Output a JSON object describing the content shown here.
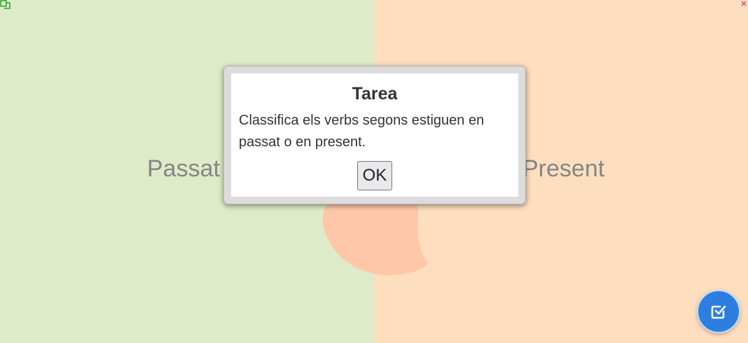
{
  "zones": {
    "left_label": "Passat",
    "right_label": "Present",
    "left_color": "#dfebc8",
    "right_color": "#fddfbf"
  },
  "dialog": {
    "title": "Tarea",
    "message": "Classifica els verbs segons estiguen en passat o en present.",
    "ok_label": "OK"
  },
  "icons": {
    "check_button": "check-square-icon",
    "top_left": "help-icon",
    "top_right": "close-icon"
  },
  "accent_color": "#2c7fe0"
}
